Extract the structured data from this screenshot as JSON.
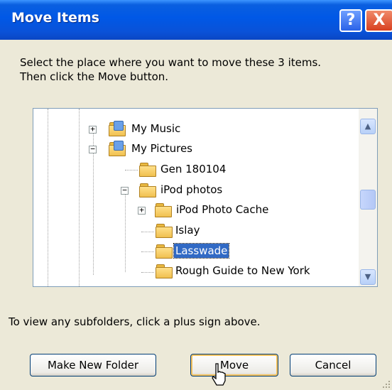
{
  "dialog": {
    "title": "Move Items",
    "help_label": "?",
    "close_label": "X",
    "instructions_line1": "Select the place where you want to move these 3 items.",
    "instructions_line2": "Then click the Move button.",
    "hint": "To view any subfolders, click a plus sign above."
  },
  "tree": {
    "items": [
      {
        "label": "My Music",
        "expander": "+",
        "selected": false
      },
      {
        "label": "My Pictures",
        "expander": "−",
        "selected": false
      },
      {
        "label": "Gen 180104",
        "expander": "",
        "selected": false
      },
      {
        "label": "iPod photos",
        "expander": "−",
        "selected": false
      },
      {
        "label": "iPod Photo Cache",
        "expander": "+",
        "selected": false
      },
      {
        "label": "Islay",
        "expander": "",
        "selected": false
      },
      {
        "label": "Lasswade",
        "expander": "",
        "selected": true
      },
      {
        "label": "Rough Guide to New York",
        "expander": "",
        "selected": false
      }
    ]
  },
  "buttons": {
    "make_new_folder": "Make New Folder",
    "move": "Move",
    "cancel": "Cancel"
  },
  "colors": {
    "title_bar": "#0058e6",
    "selection": "#316ac5",
    "dialog_bg": "#ece9d8"
  }
}
